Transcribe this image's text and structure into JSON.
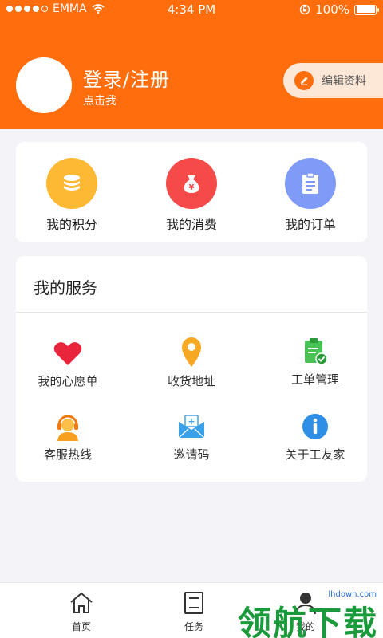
{
  "status_bar": {
    "carrier": "EMMA",
    "time": "4:34 PM",
    "battery": "100%",
    "battery_level": 1.0
  },
  "profile": {
    "title": "登录/注册",
    "subtitle": "点击我",
    "edit_label": "编辑资料"
  },
  "quick_actions": [
    {
      "label": "我的积分",
      "icon": "coins-icon",
      "color": "#fdb834"
    },
    {
      "label": "我的消费",
      "icon": "money-bag-icon",
      "color": "#f44a4a"
    },
    {
      "label": "我的订单",
      "icon": "clipboard-icon",
      "color": "#7f9bf7"
    }
  ],
  "services": {
    "title": "我的服务",
    "items": [
      {
        "label": "我的心愿单",
        "icon": "heart-icon",
        "color": "#e8253b"
      },
      {
        "label": "收货地址",
        "icon": "location-pin-icon",
        "color": "#f7a823"
      },
      {
        "label": "工单管理",
        "icon": "work-order-icon",
        "color": "#48c155"
      },
      {
        "label": "客服热线",
        "icon": "customer-service-icon",
        "color": "#f7a020"
      },
      {
        "label": "邀请码",
        "icon": "invite-envelope-icon",
        "color": "#3aa0e8"
      },
      {
        "label": "关于工友家",
        "icon": "info-icon",
        "color": "#2f8fe6"
      }
    ]
  },
  "tabbar": [
    {
      "label": "首页",
      "icon": "home-icon"
    },
    {
      "label": "任务",
      "icon": "task-icon"
    },
    {
      "label": "我的",
      "icon": "profile-icon"
    }
  ],
  "watermark": {
    "text": "领航下载",
    "url": "lhdown.com"
  },
  "colors": {
    "brand": "#ff6d0c",
    "background": "#f4f4f8"
  }
}
